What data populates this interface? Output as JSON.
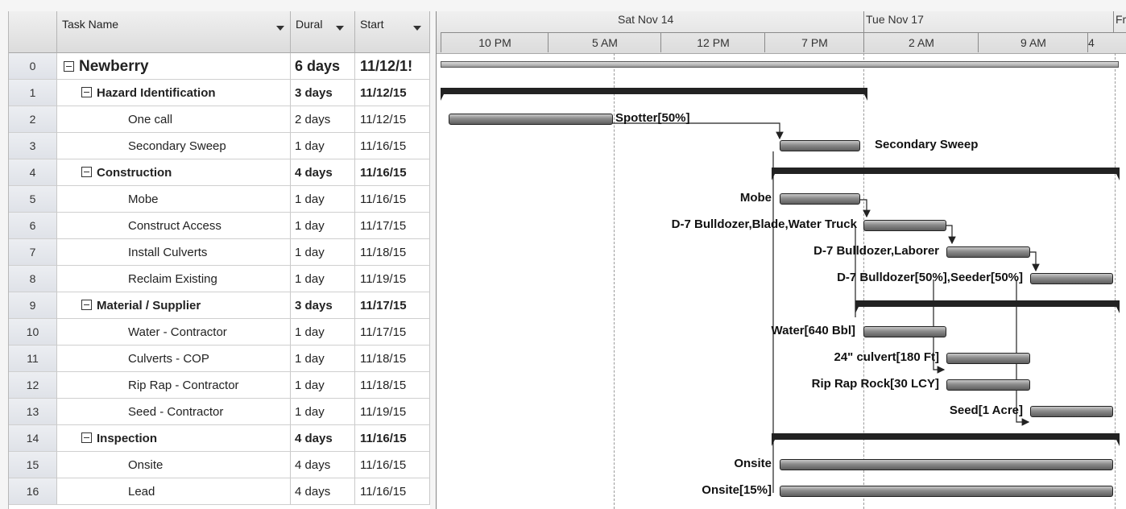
{
  "table": {
    "headers": {
      "task_name": "Task Name",
      "duration": "Dural",
      "start": "Start"
    },
    "rows": [
      {
        "id": "0",
        "name": "Newberry",
        "duration": "6 days",
        "start": "11/12/1!",
        "level": 0,
        "summary": true
      },
      {
        "id": "1",
        "name": "Hazard Identification",
        "duration": "3 days",
        "start": "11/12/15",
        "level": 1,
        "summary": true
      },
      {
        "id": "2",
        "name": "One call",
        "duration": "2 days",
        "start": "11/12/15",
        "level": 2,
        "summary": false
      },
      {
        "id": "3",
        "name": "Secondary Sweep",
        "duration": "1 day",
        "start": "11/16/15",
        "level": 2,
        "summary": false
      },
      {
        "id": "4",
        "name": "Construction",
        "duration": "4 days",
        "start": "11/16/15",
        "level": 1,
        "summary": true
      },
      {
        "id": "5",
        "name": "Mobe",
        "duration": "1 day",
        "start": "11/16/15",
        "level": 2,
        "summary": false
      },
      {
        "id": "6",
        "name": "Construct Access",
        "duration": "1 day",
        "start": "11/17/15",
        "level": 2,
        "summary": false
      },
      {
        "id": "7",
        "name": "Install Culverts",
        "duration": "1 day",
        "start": "11/18/15",
        "level": 2,
        "summary": false
      },
      {
        "id": "8",
        "name": "Reclaim Existing",
        "duration": "1 day",
        "start": "11/19/15",
        "level": 2,
        "summary": false
      },
      {
        "id": "9",
        "name": "Material / Supplier",
        "duration": "3 days",
        "start": "11/17/15",
        "level": 1,
        "summary": true
      },
      {
        "id": "10",
        "name": "Water - Contractor",
        "duration": "1 day",
        "start": "11/17/15",
        "level": 2,
        "summary": false
      },
      {
        "id": "11",
        "name": "Culverts - COP",
        "duration": "1 day",
        "start": "11/18/15",
        "level": 2,
        "summary": false
      },
      {
        "id": "12",
        "name": "Rip Rap - Contractor",
        "duration": "1 day",
        "start": "11/18/15",
        "level": 2,
        "summary": false
      },
      {
        "id": "13",
        "name": "Seed - Contractor",
        "duration": "1 day",
        "start": "11/19/15",
        "level": 2,
        "summary": false
      },
      {
        "id": "14",
        "name": "Inspection",
        "duration": "4 days",
        "start": "11/16/15",
        "level": 1,
        "summary": true
      },
      {
        "id": "15",
        "name": "Onsite",
        "duration": "4 days",
        "start": "11/16/15",
        "level": 2,
        "summary": false
      },
      {
        "id": "16",
        "name": "Lead",
        "duration": "4 days",
        "start": "11/16/15",
        "level": 2,
        "summary": false
      }
    ]
  },
  "timescale": {
    "major": [
      "Sat Nov 14",
      "Tue Nov 17",
      "Fr"
    ],
    "minor": [
      "10 PM",
      "5 AM",
      "12 PM",
      "7 PM",
      "2 AM",
      "9 AM",
      "4"
    ]
  },
  "gantt_labels": {
    "r2": "Spotter[50%]",
    "r3": "Secondary Sweep",
    "r5": "Mobe",
    "r6": "D-7 Bulldozer,Blade,Water Truck",
    "r7": "D-7 Bulldozer,Laborer",
    "r8": "D-7 Bulldozer[50%],Seeder[50%]",
    "r10": "Water[640 Bbl]",
    "r11": "24\" culvert[180 Ft]",
    "r12": "Rip Rap Rock[30 LCY]",
    "r13": "Seed[1 Acre]",
    "r15": "Onsite",
    "r16": "Onsite[15%]"
  },
  "icons": {
    "collapse": "minus-box-icon",
    "sort": "dropdown-arrow-icon"
  },
  "colors": {
    "summary_bar": "#222222",
    "task_bar": "#8a8a8a",
    "header_bg": "#dcdcdc",
    "index_bg": "#e3e6ec"
  }
}
